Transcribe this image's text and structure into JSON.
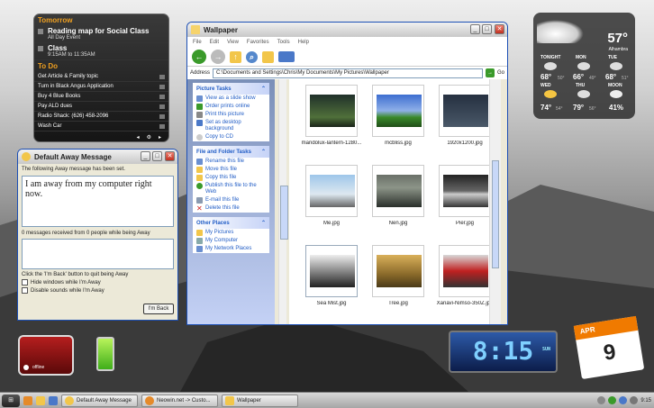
{
  "tasks_gadget": {
    "tomorrow_label": "Tomorrow",
    "events": [
      {
        "title": "Reading map for Social Class",
        "sub": "All Day Event"
      },
      {
        "title": "Class",
        "sub": "9:15AM to 11:35AM"
      }
    ],
    "todo_label": "To Do",
    "todos": [
      "Get Article & Family topic",
      "Turn in Black Angus Application",
      "Buy 4 Blue Books",
      "Pay ALD dues",
      "Radio Shack: (626) 458-2096",
      "Wash Car"
    ]
  },
  "weather": {
    "current_temp": "57°",
    "city": "Alhambra",
    "days": [
      {
        "name": "TONIGHT",
        "hi": "68°",
        "lo": "50°"
      },
      {
        "name": "MON",
        "hi": "66°",
        "lo": "49°"
      },
      {
        "name": "TUE",
        "hi": "68°",
        "lo": "51°"
      },
      {
        "name": "WED",
        "hi": "74°",
        "lo": "54°"
      },
      {
        "name": "THU",
        "hi": "79°",
        "lo": "56°"
      },
      {
        "name": "MOON",
        "hi": "41%",
        "lo": ""
      }
    ]
  },
  "explorer": {
    "title": "Wallpaper",
    "menu": [
      "File",
      "Edit",
      "View",
      "Favorites",
      "Tools",
      "Help"
    ],
    "address_label": "Address",
    "address": "C:\\Documents and Settings\\Chris\\My Documents\\My Pictures\\Wallpaper",
    "go_label": "Go",
    "panels": [
      {
        "title": "Picture Tasks",
        "items": [
          "View as a slide show",
          "Order prints online",
          "Print this picture",
          "Set as desktop background",
          "Copy to CD"
        ]
      },
      {
        "title": "File and Folder Tasks",
        "items": [
          "Rename this file",
          "Move this file",
          "Copy this file",
          "Publish this file to the Web",
          "E-mail this file",
          "Delete this file"
        ]
      },
      {
        "title": "Other Places",
        "items": [
          "My Pictures",
          "My Computer",
          "My Network Places"
        ]
      }
    ],
    "files": [
      "mandolux-lantern-1280...",
      "mcbliss.jpg",
      "1920x1200.jpg",
      "Me.jpg",
      "Nen.jpg",
      "Pier.jpg",
      "Sea Mist.jpg",
      "Tree.jpg",
      "Xanavi-Nimso-350Z.jpg"
    ]
  },
  "away": {
    "title": "Default Away Message",
    "intro": "The following Away message has been set.",
    "message": "I am away from my computer right now.",
    "received": "0 messages received from 0 people while being Away",
    "hint": "Click the 'I'm Back' button to quit being Away",
    "hide_label": "Hide windows while I'm Away",
    "disable_label": "Disable sounds while I'm Away",
    "back_button": "I'm Back"
  },
  "offline_label": "offline",
  "clock": {
    "time": "8:15",
    "day": "SUN"
  },
  "calendar": {
    "month": "APR",
    "day": "9"
  },
  "taskbar": {
    "tasks": [
      "Default Away Message",
      "Neowin.net -> Custo...",
      "Wallpaper"
    ],
    "time": "9:15"
  },
  "colors": {
    "accent": "#215dc6",
    "tasks_header": "#f0a020",
    "close": "#c03020"
  }
}
